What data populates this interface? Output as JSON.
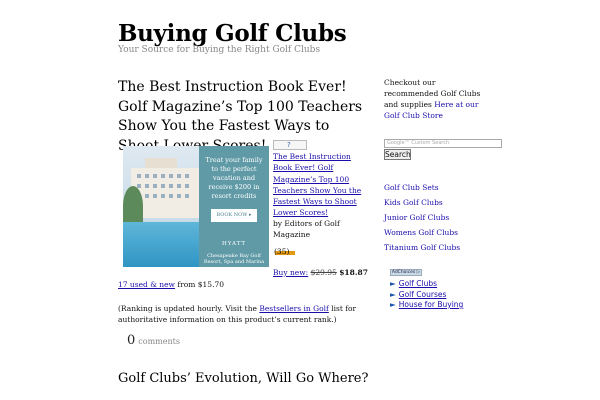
{
  "site": {
    "title": "Buying Golf Clubs",
    "description": "Your Source for Buying the Right Golf Clubs"
  },
  "post": {
    "title": "The Best Instruction Book Ever! Golf Magazine’s Top 100 Teachers Show You the Fastest Ways to Shoot Lower Scores!",
    "ad": {
      "text": "Treat your family to the perfect vacation and receive $200 in resort credits",
      "button": "BOOK NOW ▸",
      "brand": "HYATT",
      "location": "Chesapeake Bay Golf Resort, Spa and Marina"
    },
    "product": {
      "link_text": "The Best Instruction Book Ever! Golf Magazine’s Top 100 Teachers Show You the Fastest Ways to Shoot Lower Scores!",
      "author": "by Editors of Golf Magazine",
      "review_count": "(35)",
      "buy_new_label": "Buy new:",
      "old_price": "$29.95",
      "price": "$18.87",
      "used_link": "17 used & new",
      "used_from": "from $15.70"
    },
    "rank_note": {
      "before": "(Ranking is updated hourly. Visit the ",
      "link": "Bestsellers in Golf",
      "after": " list for authoritative information on this product’s current rank.)"
    },
    "comments": {
      "count": "0",
      "label": "comments"
    }
  },
  "next_post": {
    "title": "Golf Clubs’ Evolution, Will Go Where?"
  },
  "sidebar": {
    "intro": "Checkout our recommended Golf Clubs and supplies ",
    "intro_link": "Here at our Golf Club Store",
    "search": {
      "placeholder": "Google™ Custom Search",
      "button": "Search"
    },
    "links": [
      "Golf Club Sets",
      "Kids Golf Clubs",
      "Junior Golf Clubs",
      "Womens Golf Clubs",
      "Titanium Golf Clubs"
    ],
    "adchoices": "AdChoices ▷",
    "ad_links": [
      "Golf Clubs",
      "Golf Courses",
      "House for Buying"
    ]
  },
  "colors": {
    "link": "#1a0dab",
    "muted": "#888888",
    "ad_panel": "#5f9aa6"
  }
}
